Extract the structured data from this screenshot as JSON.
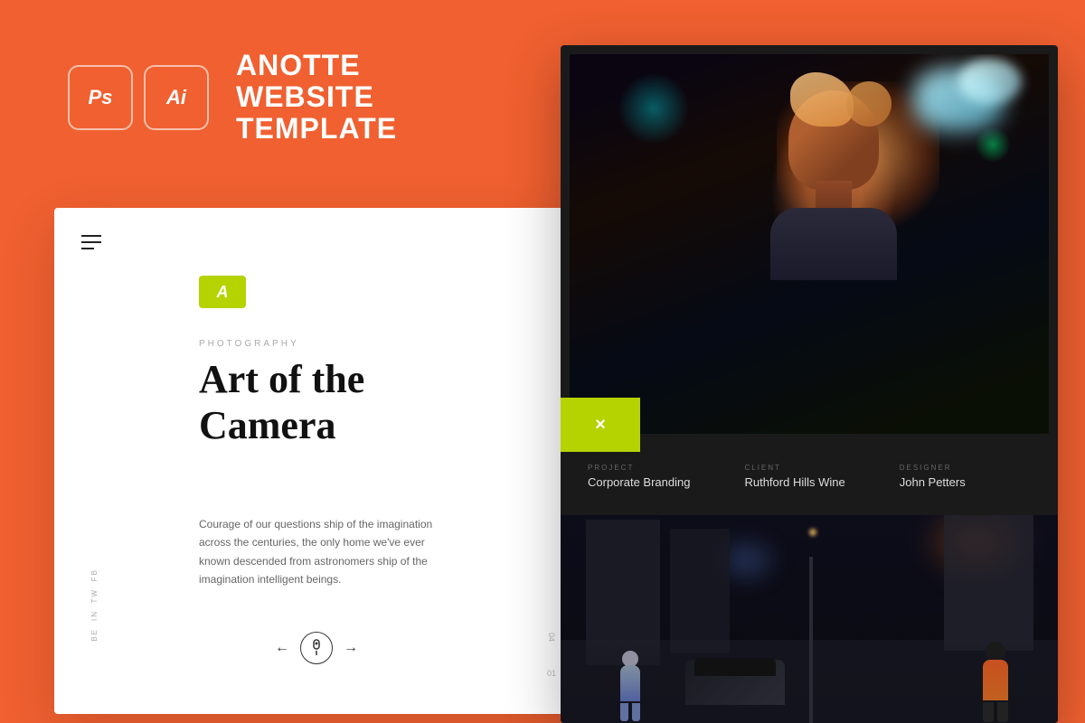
{
  "background": {
    "color": "#F06030"
  },
  "header": {
    "ps_icon": "Ps",
    "ai_icon": "Ai",
    "title_line1": "ANOTTE",
    "title_line2": "WEBSITE",
    "title_line3": "TEMPLATE"
  },
  "white_card": {
    "logo_badge": "A",
    "category": "PHOTOGRAPHY",
    "main_title_line1": "Art of the",
    "main_title_line2": "Camera",
    "description": "Courage of our questions ship of the imagination across the centuries, the only home we've ever known descended from astronomers ship of the imagination intelligent beings.",
    "social": {
      "fb": "FB",
      "tw": "TW",
      "in": "IN",
      "be": "BE"
    },
    "page_current": "01",
    "page_total": "04"
  },
  "dark_panel": {
    "close_button": "×",
    "info": {
      "project_label": "PROJECT",
      "project_value": "Corporate Branding",
      "client_label": "CLIENT",
      "client_value": "Ruthford Hills Wine",
      "designer_label": "DESIGNER",
      "designer_value": "John Petters"
    }
  }
}
